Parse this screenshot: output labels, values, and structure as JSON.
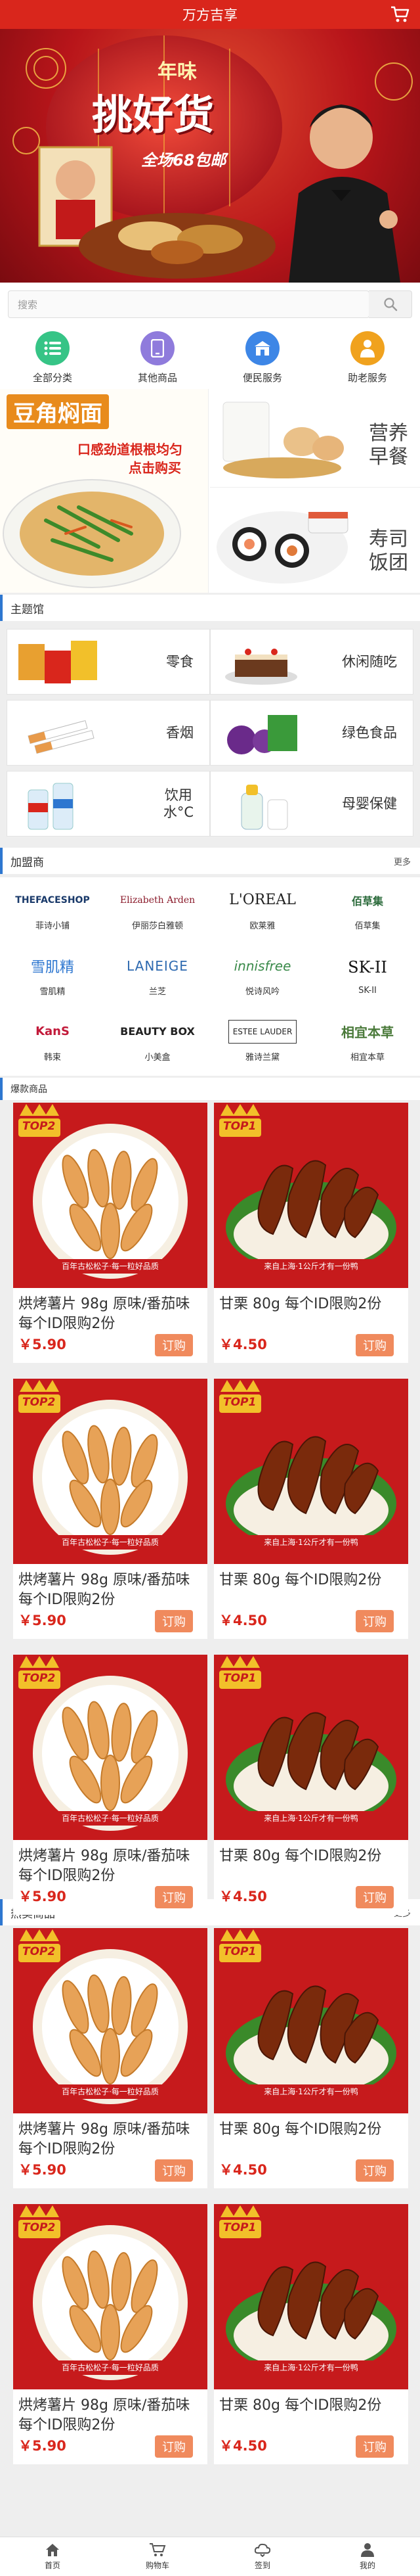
{
  "app": {
    "title": "万方吉享"
  },
  "banner": {
    "badge": "年味",
    "headline": "挑好货",
    "sub": "全场68包邮"
  },
  "search": {
    "placeholder": "搜索"
  },
  "categories": [
    {
      "label": "全部分类",
      "icon": "list-icon",
      "color": "#36c486"
    },
    {
      "label": "其他商品",
      "icon": "phone-icon",
      "color": "#8f7bdc"
    },
    {
      "label": "便民服务",
      "icon": "building-icon",
      "color": "#3d86e6"
    },
    {
      "label": "助老服务",
      "icon": "person-icon",
      "color": "#f0a21e"
    }
  ],
  "promo": {
    "main_title": "豆角焖面",
    "main_sub1": "口感劲道根根均匀",
    "main_sub2": "点击购买",
    "right1_line1": "营养",
    "right1_line2": "早餐",
    "right2_line1": "寿司",
    "right2_line2": "饭团"
  },
  "theme_section": {
    "title": "主题馆",
    "items": [
      {
        "label": "零食"
      },
      {
        "label": "休闲随吃"
      },
      {
        "label": "香烟"
      },
      {
        "label": "绿色食品"
      },
      {
        "label_line1": "饮用",
        "label_line2": "水°C"
      },
      {
        "label": "母婴保健"
      }
    ]
  },
  "brands_section": {
    "title": "加盟商",
    "more": "更多",
    "items": [
      {
        "logo": "THEFACESHOP",
        "name": "菲诗小铺"
      },
      {
        "logo": "Elizabeth Arden",
        "name": "伊丽莎白雅顿"
      },
      {
        "logo": "L'OREAL",
        "name": "欧莱雅"
      },
      {
        "logo": "佰草集",
        "name": "佰草集"
      },
      {
        "logo": "雪肌精",
        "name": "雪肌精"
      },
      {
        "logo": "LANEIGE",
        "name": "兰芝"
      },
      {
        "logo": "innisfree",
        "name": "悦诗风吟"
      },
      {
        "logo": "SK-II",
        "name": "SK-II"
      },
      {
        "logo": "KanS",
        "name": "韩束"
      },
      {
        "logo": "BEAUTY BOX",
        "name": "小美盒"
      },
      {
        "logo": "ESTEE LAUDER",
        "name": "雅诗兰黛"
      },
      {
        "logo": "相宜本草",
        "name": "相宜本草"
      }
    ]
  },
  "hot_section": {
    "title": "爆款商品"
  },
  "sale_section": {
    "title": "热卖商品",
    "more": "更多"
  },
  "product_left": {
    "rank": "TOP2",
    "name": "烘烤薯片 98g 原味/番茄味 每个ID限购2份",
    "price": "￥5.90",
    "buy": "订购",
    "slogan": "百年古松松子·每一粒好品质"
  },
  "product_right": {
    "rank": "TOP1",
    "name": "甘栗 80g 每个ID限购2份",
    "price": "￥4.50",
    "buy": "订购",
    "slogan": "来自上海·1公斤才有一份鸭"
  },
  "tabbar": [
    {
      "label": "首页",
      "icon": "home-icon"
    },
    {
      "label": "购物车",
      "icon": "cart-icon"
    },
    {
      "label": "签到",
      "icon": "checkin-icon"
    },
    {
      "label": "我的",
      "icon": "user-icon"
    }
  ],
  "colors": {
    "brand": "#d9261c",
    "accent_blue": "#2e77d0",
    "buy_button": "#f08a5d"
  }
}
